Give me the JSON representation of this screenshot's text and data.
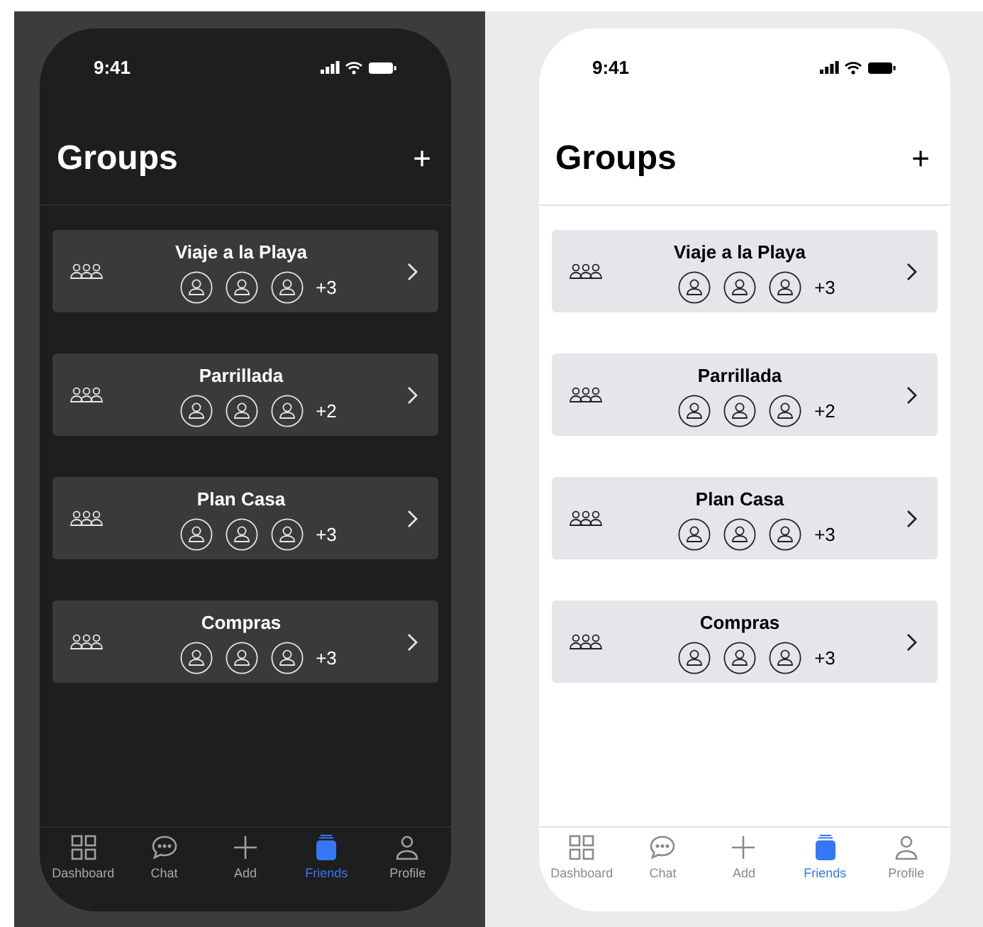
{
  "screens": [
    {
      "kind": "dark",
      "status_bar": {
        "time": "9:41"
      },
      "title": "Groups",
      "add_button": "+",
      "groups": [
        {
          "name": "Viaje a la Playa",
          "more": "+3"
        },
        {
          "name": "Parrillada",
          "more": "+2"
        },
        {
          "name": "Plan Casa",
          "more": "+3"
        },
        {
          "name": "Compras",
          "more": "+3"
        }
      ],
      "tabs": [
        {
          "label": "Dashboard",
          "selected": false
        },
        {
          "label": "Chat",
          "selected": false
        },
        {
          "label": "Add",
          "selected": false
        },
        {
          "label": "Friends",
          "selected": true
        },
        {
          "label": "Profile",
          "selected": false
        }
      ]
    },
    {
      "kind": "light",
      "status_bar": {
        "time": "9:41"
      },
      "title": "Groups",
      "add_button": "+",
      "groups": [
        {
          "name": "Viaje a la Playa",
          "more": "+3"
        },
        {
          "name": "Parrillada",
          "more": "+2"
        },
        {
          "name": "Plan Casa",
          "more": "+3"
        },
        {
          "name": "Compras",
          "more": "+3"
        }
      ],
      "tabs": [
        {
          "label": "Dashboard",
          "selected": false
        },
        {
          "label": "Chat",
          "selected": false
        },
        {
          "label": "Add",
          "selected": false
        },
        {
          "label": "Friends",
          "selected": true
        },
        {
          "label": "Profile",
          "selected": false
        }
      ]
    }
  ]
}
